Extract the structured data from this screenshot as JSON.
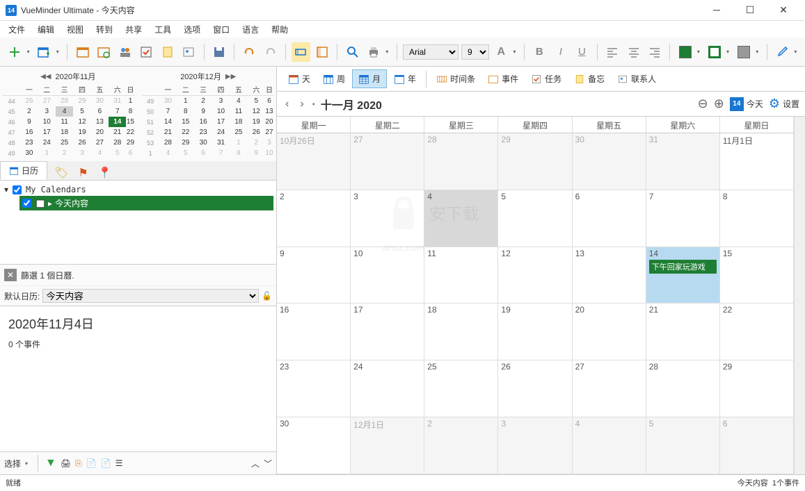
{
  "window": {
    "app_icon_text": "14",
    "title": "VueMinder Ultimate - 今天内容"
  },
  "menu": [
    "文件",
    "编辑",
    "视图",
    "转到",
    "共享",
    "工具",
    "选项",
    "窗口",
    "语言",
    "帮助"
  ],
  "font": {
    "name": "Arial",
    "size": "9"
  },
  "minical1": {
    "title": "2020年11月",
    "dow": [
      "一",
      "二",
      "三",
      "四",
      "五",
      "六",
      "日"
    ],
    "weeks": [
      {
        "wk": "44",
        "d": [
          "26",
          "27",
          "28",
          "29",
          "30",
          "31",
          "1"
        ],
        "dim": [
          0,
          1,
          2,
          3,
          4,
          5
        ]
      },
      {
        "wk": "45",
        "d": [
          "2",
          "3",
          "4",
          "5",
          "6",
          "7",
          "8"
        ],
        "sel": 2
      },
      {
        "wk": "46",
        "d": [
          "9",
          "10",
          "11",
          "12",
          "13",
          "14",
          "15"
        ],
        "today": 5
      },
      {
        "wk": "47",
        "d": [
          "16",
          "17",
          "18",
          "19",
          "20",
          "21",
          "22"
        ]
      },
      {
        "wk": "48",
        "d": [
          "23",
          "24",
          "25",
          "26",
          "27",
          "28",
          "29"
        ]
      },
      {
        "wk": "49",
        "d": [
          "30",
          "1",
          "2",
          "3",
          "4",
          "5",
          "6"
        ],
        "dim": [
          1,
          2,
          3,
          4,
          5,
          6
        ]
      }
    ]
  },
  "minical2": {
    "title": "2020年12月",
    "dow": [
      "一",
      "二",
      "三",
      "四",
      "五",
      "六",
      "日"
    ],
    "weeks": [
      {
        "wk": "49",
        "d": [
          "30",
          "1",
          "2",
          "3",
          "4",
          "5",
          "6"
        ],
        "dim": [
          0
        ]
      },
      {
        "wk": "50",
        "d": [
          "7",
          "8",
          "9",
          "10",
          "11",
          "12",
          "13"
        ]
      },
      {
        "wk": "51",
        "d": [
          "14",
          "15",
          "16",
          "17",
          "18",
          "19",
          "20"
        ]
      },
      {
        "wk": "52",
        "d": [
          "21",
          "22",
          "23",
          "24",
          "25",
          "26",
          "27"
        ]
      },
      {
        "wk": "53",
        "d": [
          "28",
          "29",
          "30",
          "31",
          "1",
          "2",
          "3"
        ],
        "dim": [
          4,
          5,
          6
        ]
      },
      {
        "wk": "1",
        "d": [
          "4",
          "5",
          "6",
          "7",
          "8",
          "9",
          "10"
        ],
        "dim": [
          0,
          1,
          2,
          3,
          4,
          5,
          6
        ]
      }
    ]
  },
  "sidebar": {
    "tab_calendar": "日历",
    "tree_root": "My Calendars",
    "tree_item": "今天内容",
    "filter_label": "篩選 1 個日曆.",
    "default_label": "默认日历:",
    "default_value": "今天内容",
    "select_label": "选择"
  },
  "detail": {
    "date": "2020年11月4日",
    "events": "0 个事件"
  },
  "viewbar": {
    "day": "天",
    "week": "周",
    "month": "月",
    "year": "年",
    "timeline": "时间条",
    "events": "事件",
    "tasks": "任务",
    "notes": "备忘",
    "contacts": "联系人"
  },
  "nav": {
    "title": "十一月 2020",
    "today": "今天",
    "settings": "设置"
  },
  "dayheaders": [
    "星期一",
    "星期二",
    "星期三",
    "星期四",
    "星期五",
    "星期六",
    "星期日"
  ],
  "grid": [
    [
      {
        "t": "10月26日",
        "dim": 1
      },
      {
        "t": "27",
        "dim": 1
      },
      {
        "t": "28",
        "dim": 1
      },
      {
        "t": "29",
        "dim": 1
      },
      {
        "t": "30",
        "dim": 1
      },
      {
        "t": "31",
        "dim": 1
      },
      {
        "t": "11月1日"
      }
    ],
    [
      {
        "t": "2"
      },
      {
        "t": "3"
      },
      {
        "t": "4",
        "sel": 1
      },
      {
        "t": "5"
      },
      {
        "t": "6"
      },
      {
        "t": "7"
      },
      {
        "t": "8"
      }
    ],
    [
      {
        "t": "9"
      },
      {
        "t": "10"
      },
      {
        "t": "11"
      },
      {
        "t": "12"
      },
      {
        "t": "13"
      },
      {
        "t": "14",
        "today": 1,
        "ev": "下午回家玩游戏"
      },
      {
        "t": "15"
      }
    ],
    [
      {
        "t": "16"
      },
      {
        "t": "17"
      },
      {
        "t": "18"
      },
      {
        "t": "19"
      },
      {
        "t": "20"
      },
      {
        "t": "21"
      },
      {
        "t": "22"
      }
    ],
    [
      {
        "t": "23"
      },
      {
        "t": "24"
      },
      {
        "t": "25"
      },
      {
        "t": "26"
      },
      {
        "t": "27"
      },
      {
        "t": "28"
      },
      {
        "t": "29"
      }
    ],
    [
      {
        "t": "30"
      },
      {
        "t": "12月1日",
        "dim": 1
      },
      {
        "t": "2",
        "dim": 1
      },
      {
        "t": "3",
        "dim": 1
      },
      {
        "t": "4",
        "dim": 1
      },
      {
        "t": "5",
        "dim": 1
      },
      {
        "t": "6",
        "dim": 1
      }
    ]
  ],
  "status": {
    "ready": "就绪",
    "right1": "今天内容",
    "right2": "1个事件"
  }
}
